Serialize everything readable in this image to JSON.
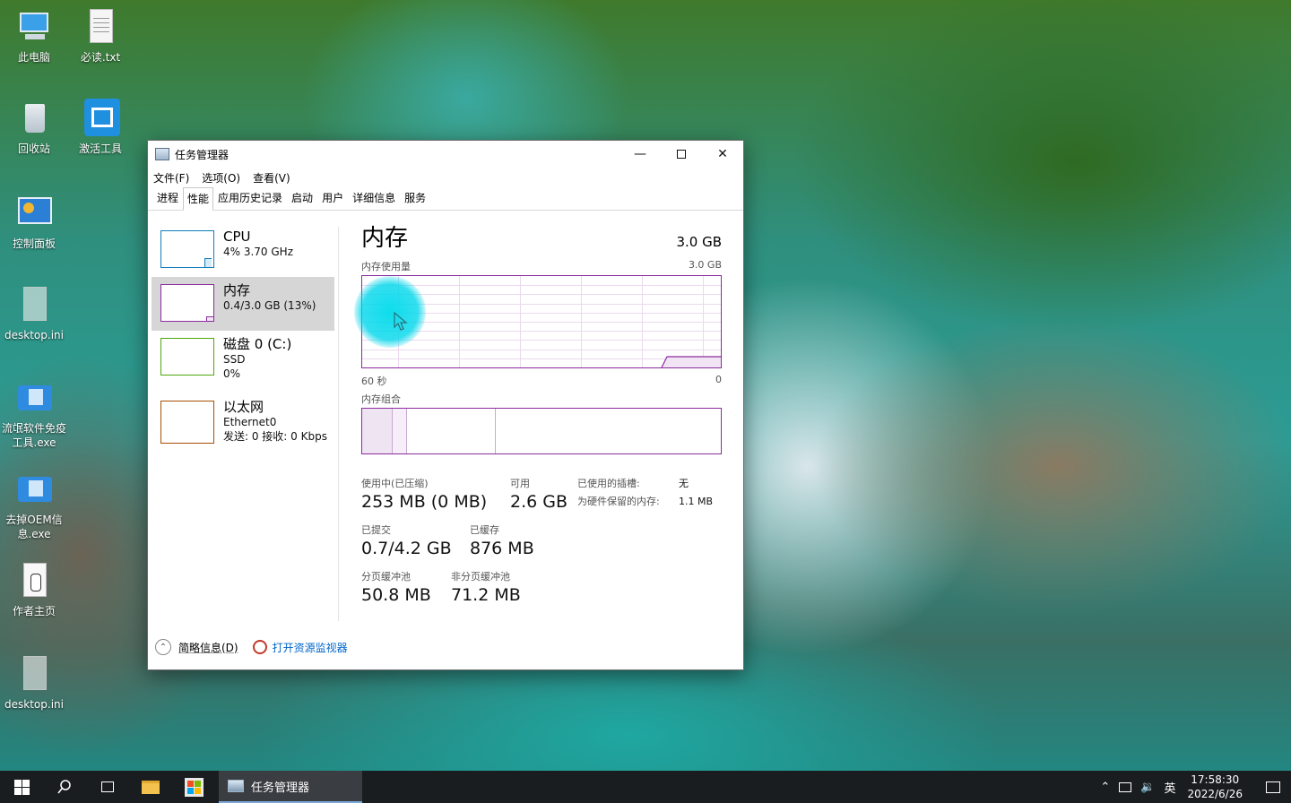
{
  "desktop": {
    "icons": [
      {
        "label": "此电脑",
        "icon": "computer-icon"
      },
      {
        "label": "必读.txt",
        "icon": "text-file-icon"
      },
      {
        "label": "回收站",
        "icon": "recycle-bin-icon"
      },
      {
        "label": "激活工具",
        "icon": "activation-tool-icon"
      },
      {
        "label": "控制面板",
        "icon": "control-panel-icon"
      },
      {
        "label": "desktop.ini",
        "icon": "ini-file-icon"
      },
      {
        "label": "流氓软件免疫工具.exe",
        "icon": "exe-icon"
      },
      {
        "label": "去掉OEM信息.exe",
        "icon": "exe-icon"
      },
      {
        "label": "作者主页",
        "icon": "hand-link-icon"
      },
      {
        "label": "desktop.ini",
        "icon": "ini-file-icon"
      }
    ]
  },
  "window": {
    "title": "任务管理器",
    "menu": [
      "文件(F)",
      "选项(O)",
      "查看(V)"
    ],
    "tabs": [
      "进程",
      "性能",
      "应用历史记录",
      "启动",
      "用户",
      "详细信息",
      "服务"
    ],
    "active_tab": "性能"
  },
  "perf_list": [
    {
      "title": "CPU",
      "sub1": "4% 3.70 GHz",
      "sub2": "",
      "color": "#117dbb"
    },
    {
      "title": "内存",
      "sub1": "0.4/3.0 GB (13%)",
      "sub2": "",
      "color": "#8b2b9e"
    },
    {
      "title": "磁盘 0 (C:)",
      "sub1": "SSD",
      "sub2": "0%",
      "color": "#4da60c"
    },
    {
      "title": "以太网",
      "sub1": "Ethernet0",
      "sub2": "发送: 0  接收: 0 Kbps",
      "color": "#a74f01"
    }
  ],
  "memory": {
    "title": "内存",
    "capacity": "3.0 GB",
    "usage_label": "内存使用量",
    "usage_max": "3.0 GB",
    "axis_left": "60 秒",
    "axis_right": "0",
    "composition_label": "内存组合",
    "stats": {
      "in_use_label": "使用中(已压缩)",
      "in_use": "253 MB (0 MB)",
      "available_label": "可用",
      "available": "2.6 GB",
      "committed_label": "已提交",
      "committed": "0.7/4.2 GB",
      "cached_label": "已缓存",
      "cached": "876 MB",
      "paged_label": "分页缓冲池",
      "paged": "50.8 MB",
      "nonpaged_label": "非分页缓冲池",
      "nonpaged": "71.2 MB",
      "slots_label": "已使用的插槽:",
      "slots": "无",
      "reserved_label": "为硬件保留的内存:",
      "reserved": "1.1 MB"
    }
  },
  "footer": {
    "brief_label": "简略信息(D)",
    "resmon_label": "打开资源监视器"
  },
  "taskbar": {
    "app_label": "任务管理器",
    "ime": "英",
    "time": "17:58:30",
    "date": "2022/6/26"
  }
}
